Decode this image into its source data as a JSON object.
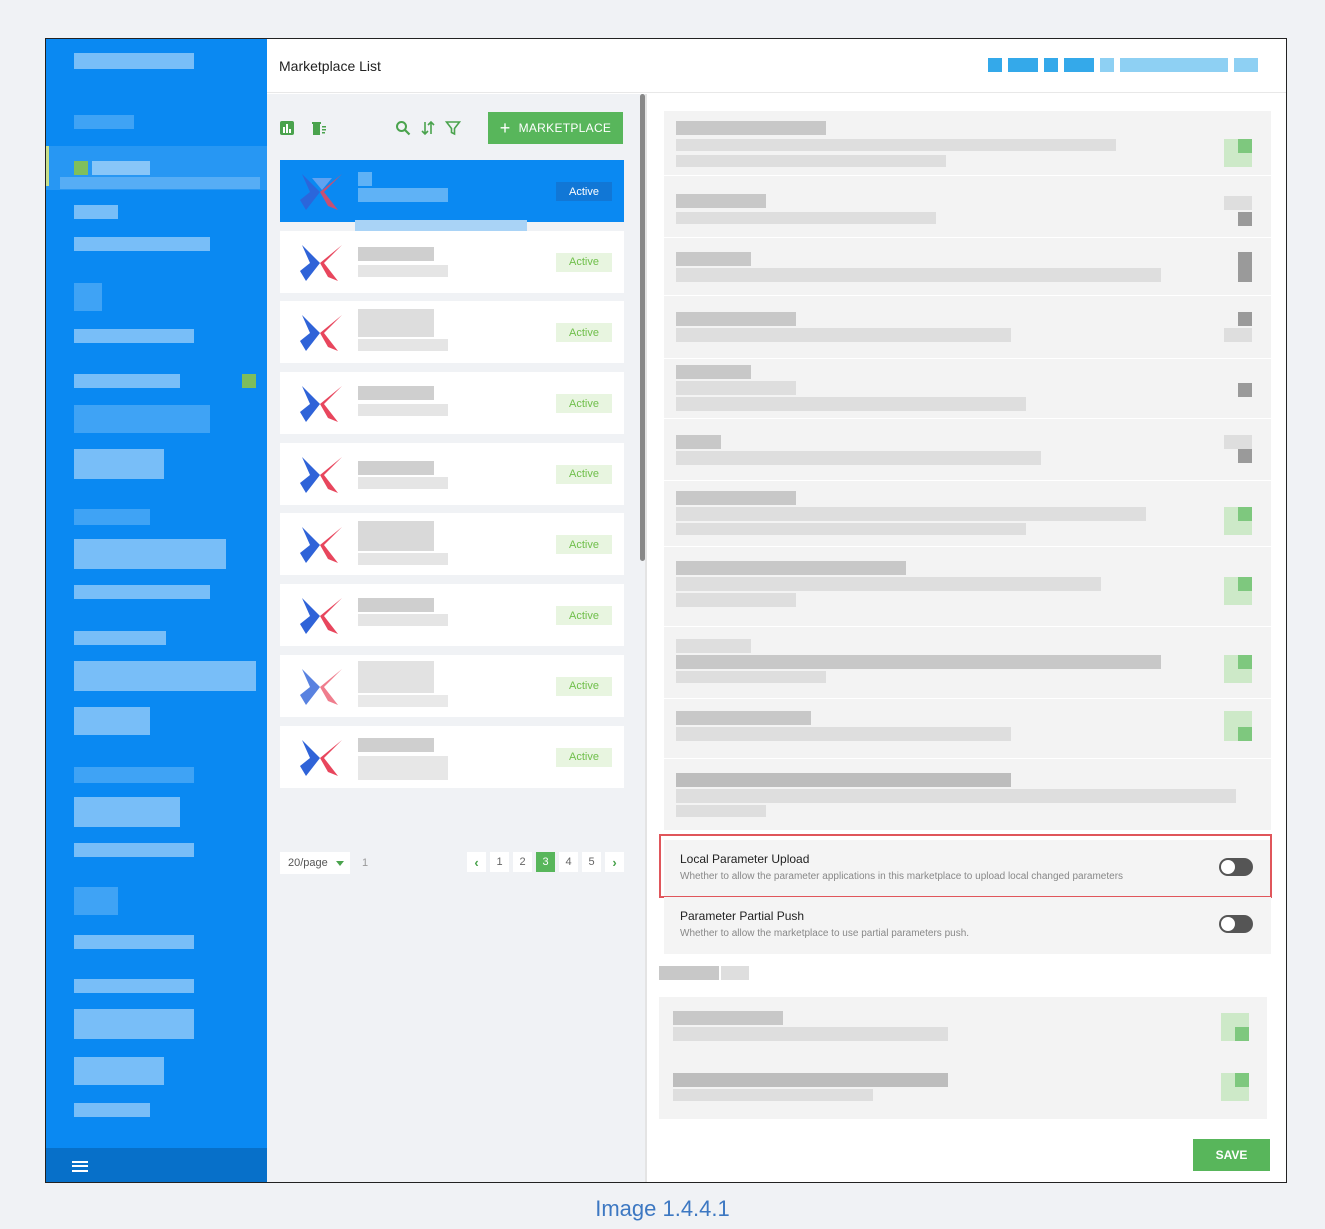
{
  "header": {
    "title": "Marketplace List"
  },
  "toolbar": {
    "icons": [
      "chart-icon",
      "delete-list-icon",
      "search-icon",
      "sort-icon",
      "filter-icon"
    ],
    "add_button_label": "MARKETPLACE"
  },
  "marketplaces": [
    {
      "status": "Active",
      "selected": true
    },
    {
      "status": "Active"
    },
    {
      "status": "Active"
    },
    {
      "status": "Active"
    },
    {
      "status": "Active"
    },
    {
      "status": "Active"
    },
    {
      "status": "Active"
    },
    {
      "status": "Active"
    },
    {
      "status": "Active"
    }
  ],
  "pagination": {
    "page_size": "20/page",
    "total": "1",
    "pages": [
      "1",
      "2",
      "3",
      "4",
      "5"
    ],
    "current": "3"
  },
  "settings": [
    {
      "title": "Local Parameter Upload",
      "description": "Whether to allow the parameter applications in this marketplace to upload local changed parameters",
      "enabled": false
    },
    {
      "title": "Parameter Partial Push",
      "description": "Whether to allow the marketplace to use partial parameters push.",
      "enabled": false
    }
  ],
  "save_label": "SAVE",
  "caption": "Image 1.4.4.1",
  "colors": {
    "sidebar": "#0a89f2",
    "primary_green": "#58b65b",
    "highlight": "#e0565b"
  }
}
